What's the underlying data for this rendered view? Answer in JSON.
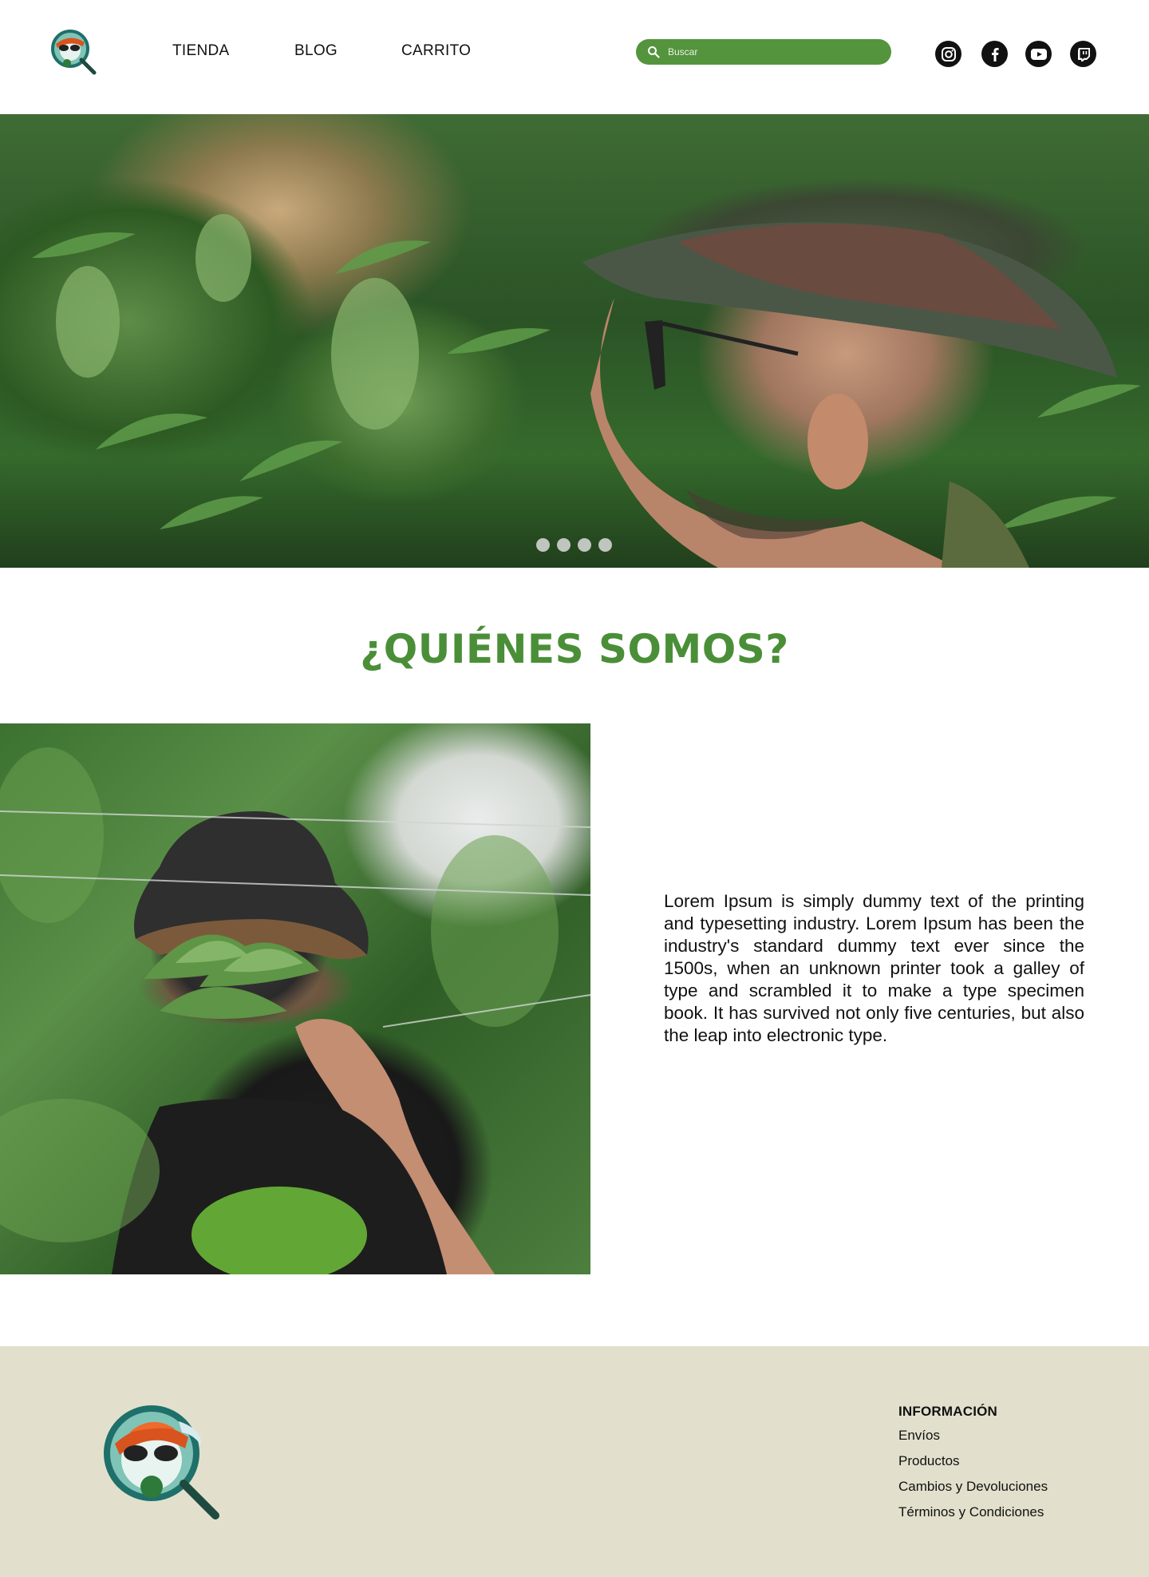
{
  "header": {
    "logo_alt": "Dr. Green logo",
    "nav": [
      {
        "label": "TIENDA"
      },
      {
        "label": "BLOG"
      },
      {
        "label": "CARRITO"
      }
    ],
    "search": {
      "placeholder": "Buscar",
      "value": ""
    },
    "social": [
      {
        "name": "instagram-icon"
      },
      {
        "name": "facebook-icon"
      },
      {
        "name": "youtube-icon"
      },
      {
        "name": "twitch-icon"
      }
    ]
  },
  "hero": {
    "carousel_dots": 4,
    "active_dot": 0
  },
  "about": {
    "title": "¿QUIÉNES SOMOS?",
    "body": "Lorem Ipsum is simply dummy text of the printing and typesetting industry. Lorem Ipsum has been the industry's standard dummy text ever since the 1500s, when an unknown printer took a galley of type and scrambled it to make a type specimen book. It has survived not only five centuries, but also the leap into electronic type."
  },
  "footer": {
    "heading": "INFORMACIÓN",
    "links": [
      {
        "label": "Envíos"
      },
      {
        "label": "Productos"
      },
      {
        "label": "Cambios y Devoluciones"
      },
      {
        "label": "Términos y Condiciones"
      }
    ]
  },
  "colors": {
    "accent_green": "#54943d",
    "title_green": "#4a8f38",
    "footer_bg": "#e2e0cc"
  }
}
